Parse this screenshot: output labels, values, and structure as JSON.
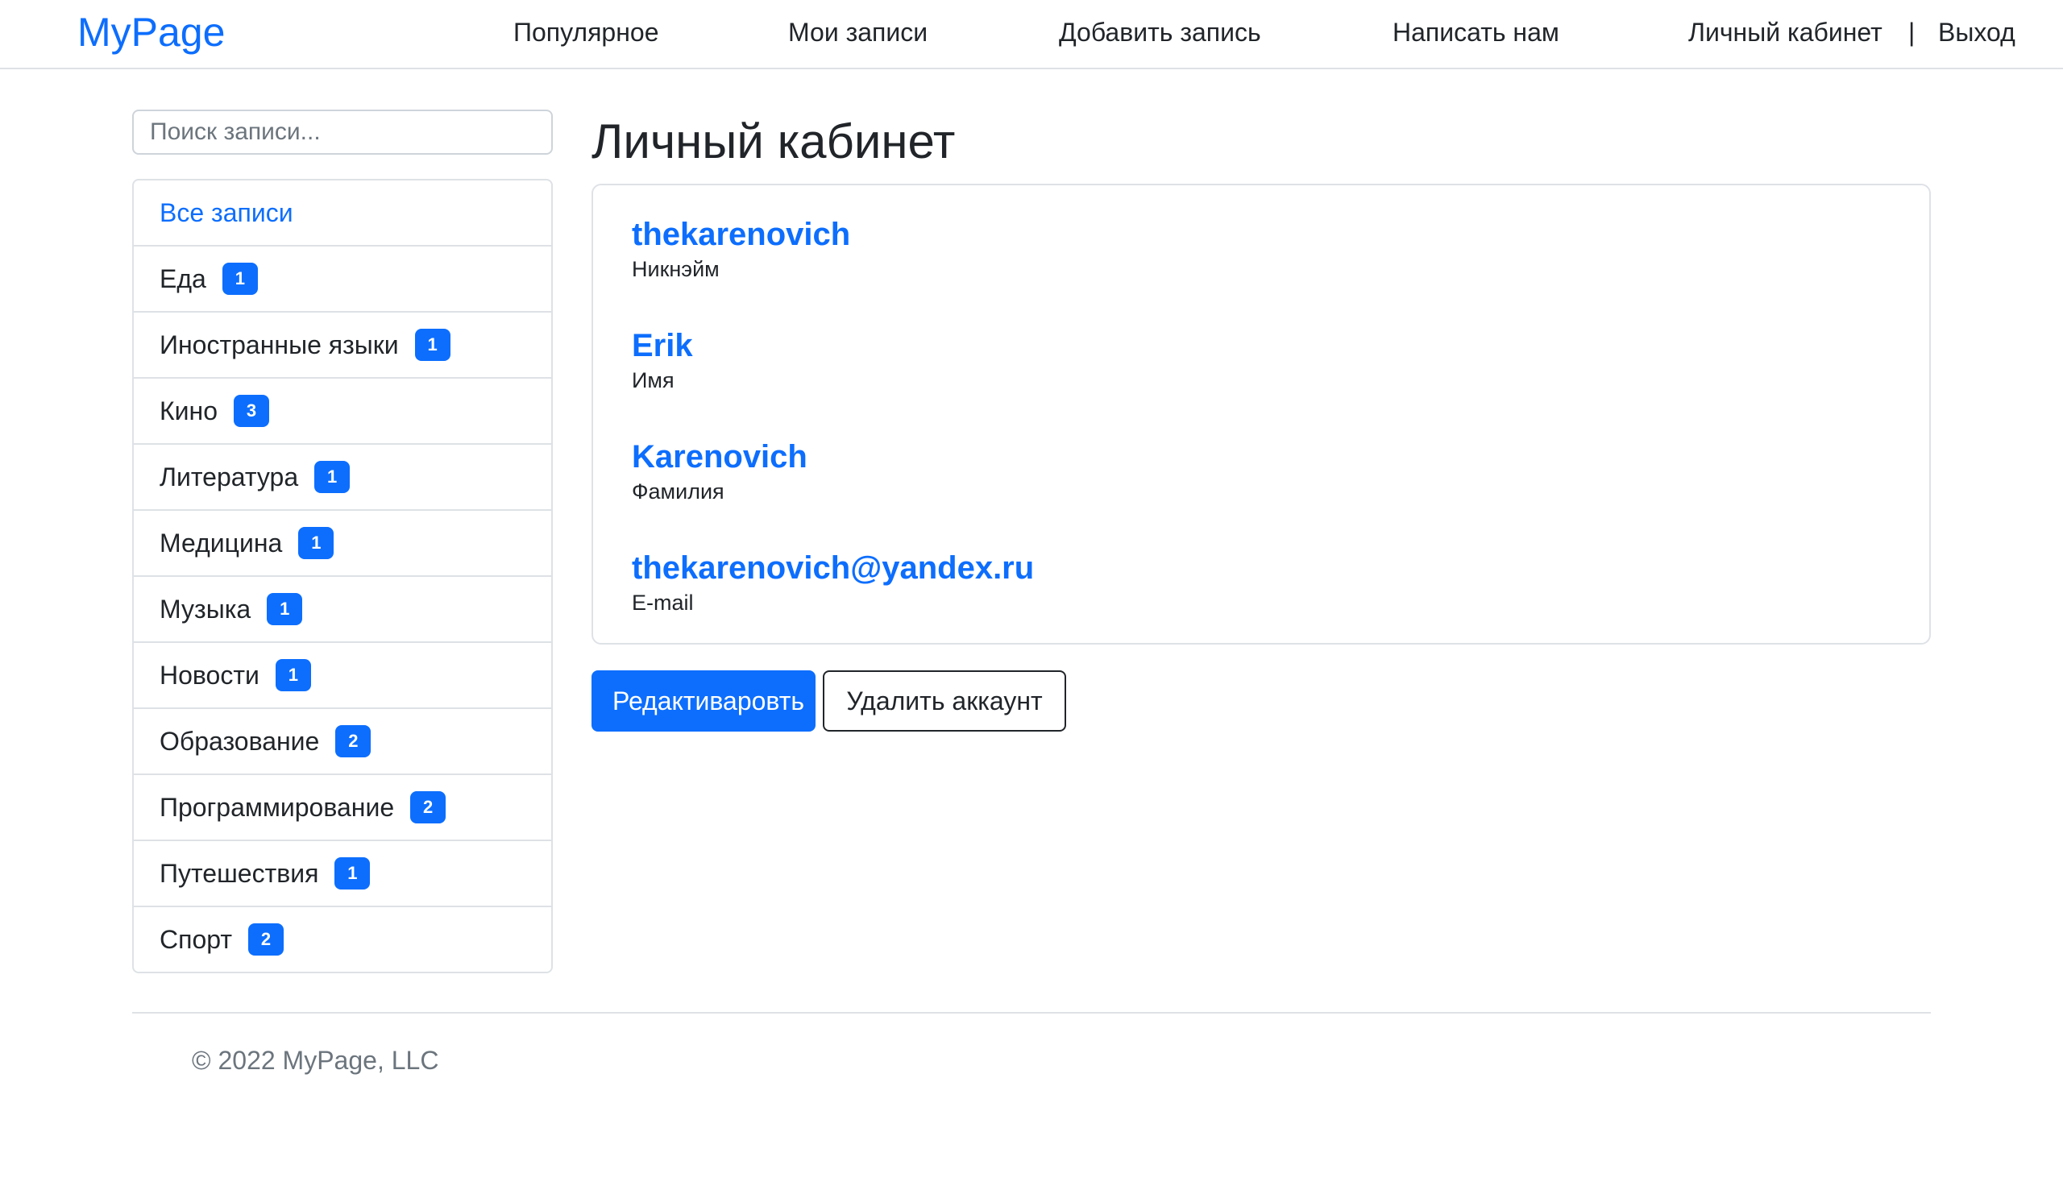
{
  "header": {
    "logo": "MyPage",
    "nav": [
      "Популярное",
      "Мои записи",
      "Добавить запись",
      "Написать нам"
    ],
    "account_link": "Личный кабинет",
    "separator": "|",
    "logout_link": "Выход"
  },
  "sidebar": {
    "search_placeholder": "Поиск записи...",
    "all_posts": "Все записи",
    "categories": [
      {
        "label": "Еда",
        "count": "1"
      },
      {
        "label": "Иностранные языки",
        "count": "1"
      },
      {
        "label": "Кино",
        "count": "3"
      },
      {
        "label": "Литература",
        "count": "1"
      },
      {
        "label": "Медицина",
        "count": "1"
      },
      {
        "label": "Музыка",
        "count": "1"
      },
      {
        "label": "Новости",
        "count": "1"
      },
      {
        "label": "Образование",
        "count": "2"
      },
      {
        "label": "Программирование",
        "count": "2"
      },
      {
        "label": "Путешествия",
        "count": "1"
      },
      {
        "label": "Спорт",
        "count": "2"
      }
    ]
  },
  "main": {
    "title": "Личный кабинет",
    "profile": [
      {
        "value": "thekarenovich",
        "label": "Никнэйм"
      },
      {
        "value": "Erik",
        "label": "Имя"
      },
      {
        "value": "Karenovich",
        "label": "Фамилия"
      },
      {
        "value": "thekarenovich@yandex.ru",
        "label": "E-mail"
      }
    ],
    "edit_button": "Редактиваровть",
    "delete_button": "Удалить аккаунт"
  },
  "footer": {
    "copyright": "© 2022 MyPage, LLC"
  },
  "colors": {
    "accent": "#0d6efd",
    "text": "#212529",
    "border": "#dee2e6",
    "muted": "#6c757d"
  }
}
